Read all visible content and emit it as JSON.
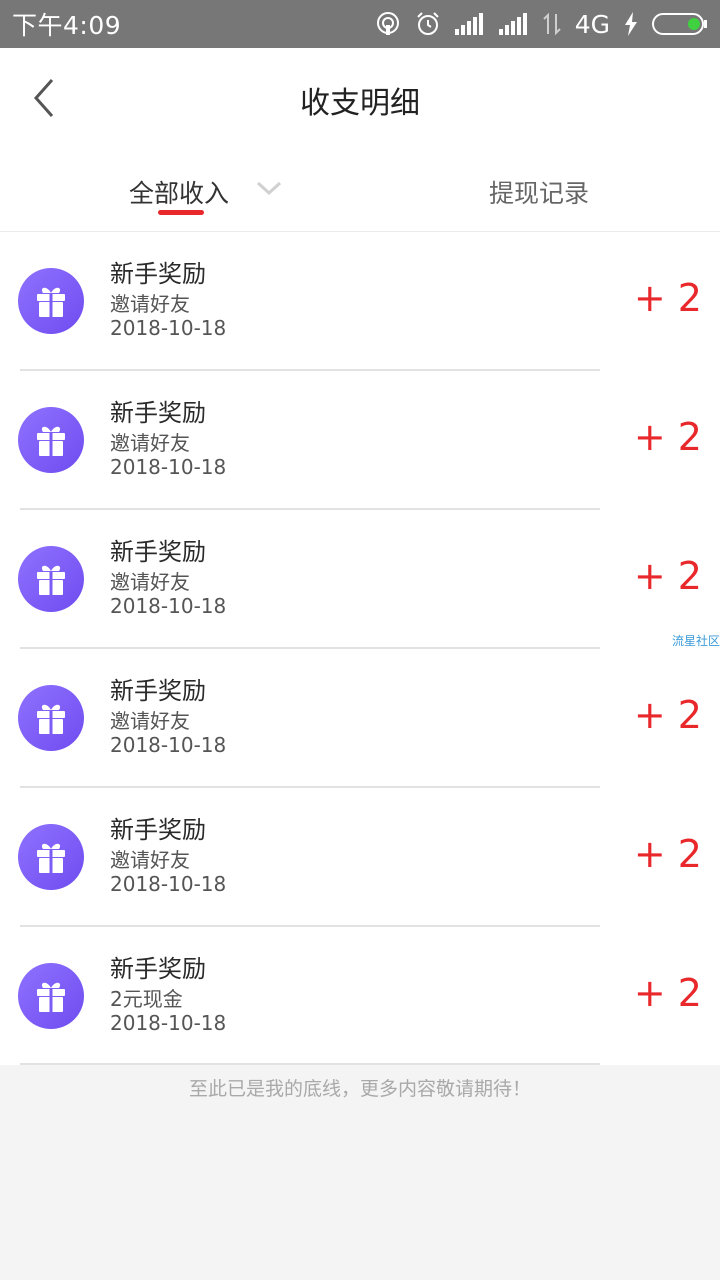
{
  "status_bar": {
    "time": "下午4:09",
    "network": "4G",
    "icons": [
      "hotspot-icon",
      "alarm-icon",
      "signal-icon",
      "signal-icon",
      "data-arrows-icon",
      "charging-icon",
      "battery-icon"
    ]
  },
  "header": {
    "back_icon": "chevron-left-icon",
    "title": "收支明细"
  },
  "tabs": {
    "all_income": "全部收入",
    "withdraw_records": "提现记录",
    "active_color": "#e8282b"
  },
  "list": {
    "items": [
      {
        "title": "新手奖励",
        "subtitle": "邀请好友",
        "date": "2018-10-18",
        "amount": "+ 2"
      },
      {
        "title": "新手奖励",
        "subtitle": "邀请好友",
        "date": "2018-10-18",
        "amount": "+ 2"
      },
      {
        "title": "新手奖励",
        "subtitle": "邀请好友",
        "date": "2018-10-18",
        "amount": "+ 2"
      },
      {
        "title": "新手奖励",
        "subtitle": "邀请好友",
        "date": "2018-10-18",
        "amount": "+ 2"
      },
      {
        "title": "新手奖励",
        "subtitle": "邀请好友",
        "date": "2018-10-18",
        "amount": "+ 2"
      },
      {
        "title": "新手奖励",
        "subtitle": "2元现金",
        "date": "2018-10-18",
        "amount": "+ 2"
      }
    ],
    "icon": "gift-icon",
    "amount_color": "#e8282b",
    "icon_color": "#7b5cf5"
  },
  "watermark": "流星社区",
  "footer": {
    "note": "至此已是我的底线，更多内容敬请期待！"
  }
}
